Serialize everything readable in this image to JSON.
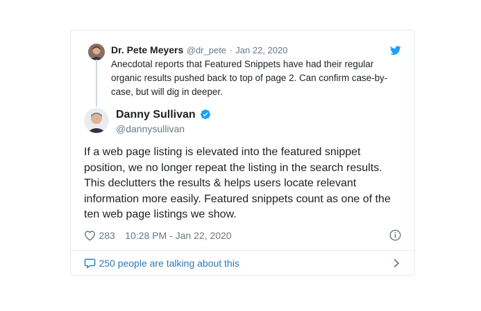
{
  "quoted_tweet": {
    "author_name": "Dr. Pete Meyers",
    "author_handle": "@dr_pete",
    "separator": "·",
    "date": "Jan 22, 2020",
    "text": "Anecdotal reports that Featured Snippets have had their regular organic results pushed back to top of page 2. Can confirm case-by-case, but will dig in deeper."
  },
  "tweet": {
    "author_name": "Danny Sullivan",
    "author_handle": "@dannysullivan",
    "verified": true,
    "text": "If a web page listing is elevated into the featured snippet position, we no longer repeat the listing in the search results. This declutters the results & helps users locate relevant information more easily. Featured snippets count as one of the ten web page listings we show.",
    "likes": "283",
    "timestamp": "10:28 PM - Jan 22, 2020"
  },
  "footer": {
    "conversation_text": "250 people are talking about this"
  },
  "colors": {
    "twitter_blue": "#1da1f2",
    "link_blue": "#2b7bb9",
    "muted": "#697882",
    "border": "#e1e8ed"
  },
  "icons": [
    "twitter-bird-icon",
    "verified-badge-icon",
    "heart-icon",
    "info-icon",
    "comment-icon",
    "chevron-right-icon"
  ]
}
